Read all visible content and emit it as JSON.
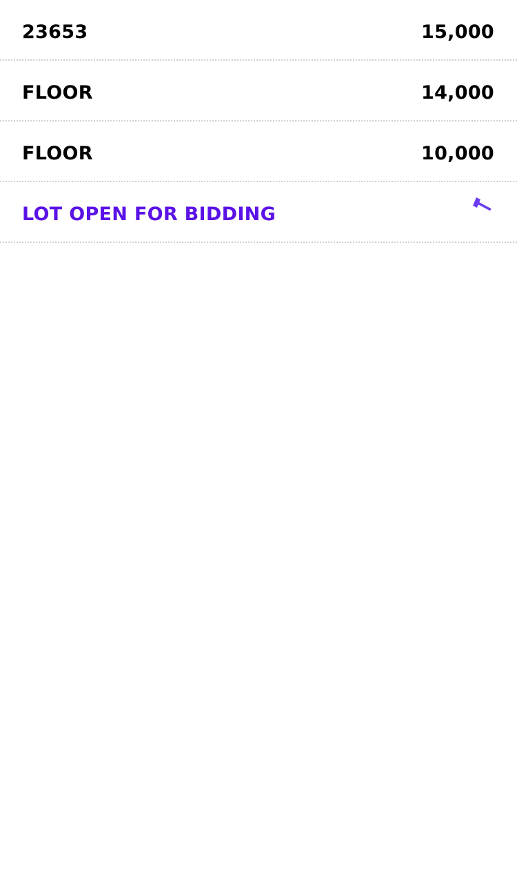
{
  "bids": [
    {
      "bidder": "23653",
      "amount": "15,000"
    },
    {
      "bidder": "FLOOR",
      "amount": "14,000"
    },
    {
      "bidder": "FLOOR",
      "amount": "10,000"
    }
  ],
  "status": {
    "label": "LOT OPEN FOR BIDDING",
    "icon": "gavel-icon"
  },
  "colors": {
    "accent": "#5a12e6",
    "icon": "#6a3cf0",
    "text": "#000000",
    "divider": "#cfcfcf"
  }
}
